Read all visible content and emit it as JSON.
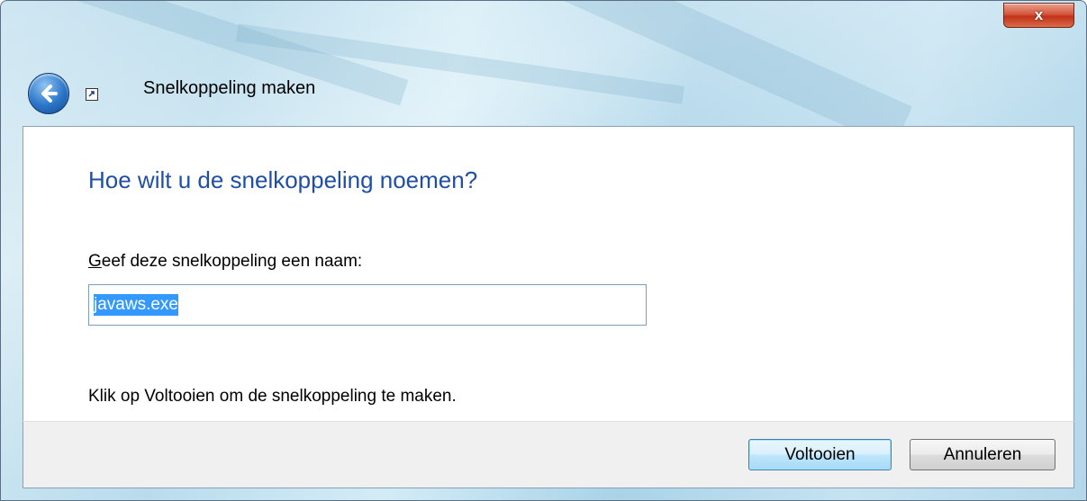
{
  "window": {
    "title": "Snelkoppeling maken",
    "close_glyph": "x"
  },
  "wizard": {
    "heading": "Hoe wilt u de snelkoppeling noemen?",
    "name_label_accesskey": "G",
    "name_label_rest": "eef deze snelkoppeling een naam:",
    "name_value": "javaws.exe",
    "note": "Klik op Voltooien om de snelkoppeling te maken."
  },
  "buttons": {
    "finish": "Voltooien",
    "cancel": "Annuleren"
  },
  "icons": {
    "back": "back-arrow-icon",
    "close": "close-icon",
    "shortcut": "shortcut-arrow-icon"
  }
}
